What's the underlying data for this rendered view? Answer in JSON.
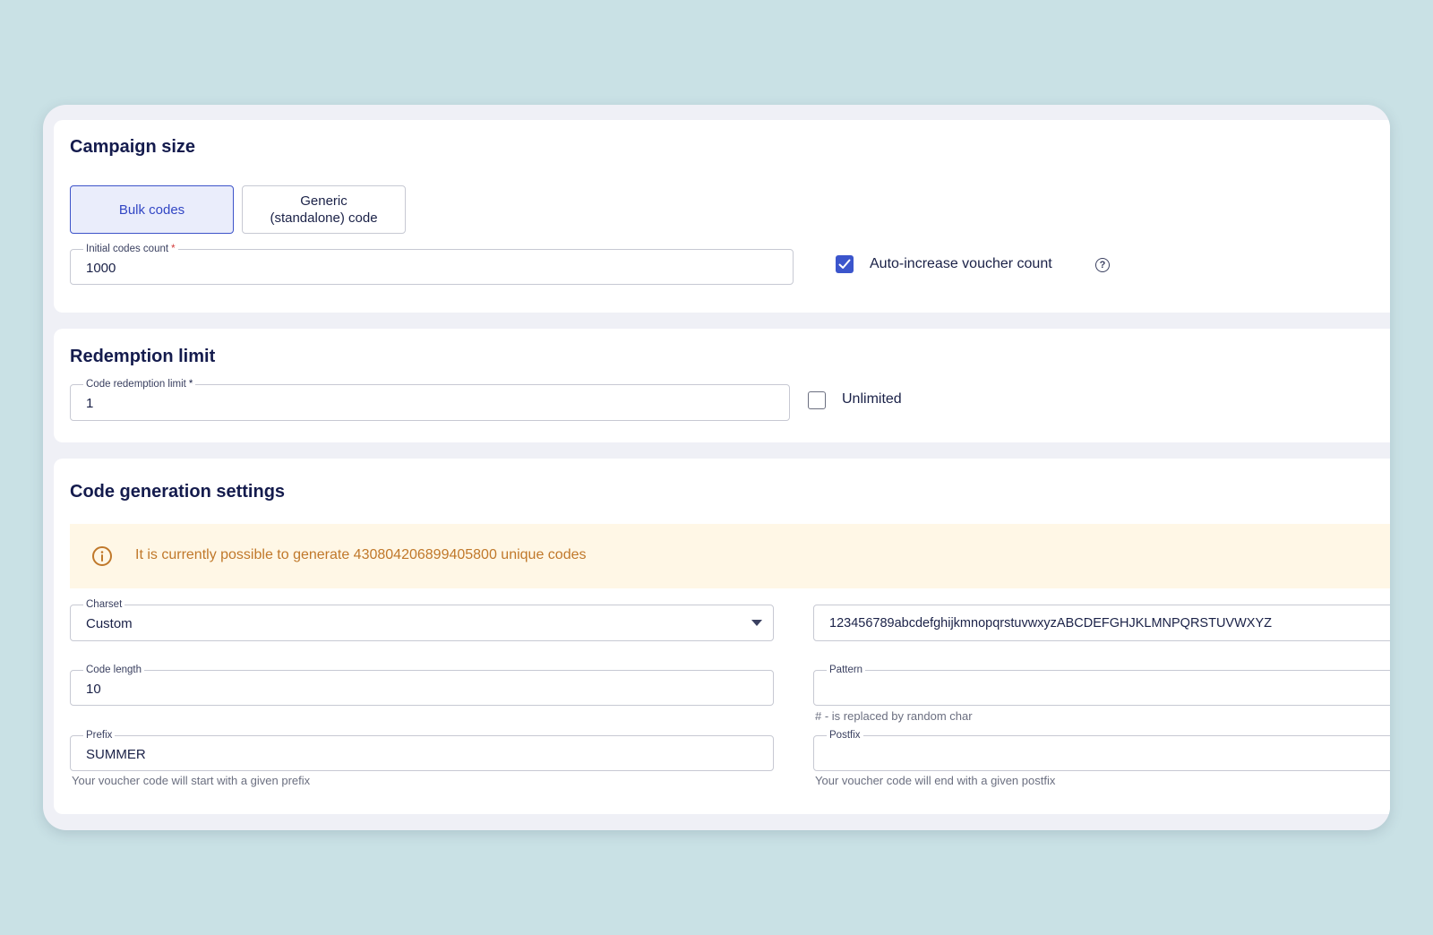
{
  "campaign_size": {
    "title": "Campaign size",
    "bulk_codes_label": "Bulk codes",
    "generic_code_label": "Generic\n(standalone) code",
    "initial_codes": {
      "label": "Initial codes count",
      "required_mark": "*",
      "value": "1000"
    },
    "auto_increase": {
      "label": "Auto-increase voucher count",
      "checked": true,
      "help_glyph": "?"
    }
  },
  "redemption_limit": {
    "title": "Redemption limit",
    "code_limit": {
      "label": "Code redemption limit",
      "required_mark": "*",
      "value": "1"
    },
    "unlimited": {
      "label": "Unlimited",
      "checked": false
    }
  },
  "code_generation": {
    "title": "Code generation settings",
    "info_text": "It is currently possible to generate 430804206899405800 unique codes",
    "charset": {
      "label": "Charset",
      "value": "Custom",
      "custom_chars": "123456789abcdefghijkmnopqrstuvwxyzABCDEFGHJKLMNPQRSTUVWXYZ"
    },
    "code_length": {
      "label": "Code length",
      "value": "10"
    },
    "pattern": {
      "label": "Pattern",
      "value": "",
      "helper": "# - is replaced by random char"
    },
    "prefix": {
      "label": "Prefix",
      "value": "SUMMER",
      "helper": "Your voucher code will start with a given prefix"
    },
    "postfix": {
      "label": "Postfix",
      "value": "",
      "helper": "Your voucher code will end with a given postfix"
    }
  },
  "colors": {
    "background": "#c9e1e5",
    "accent": "#3b55cc",
    "info_bg": "#fff7e6",
    "info_text": "#c0782a"
  },
  "icons": [
    "check-icon",
    "help-circle-icon",
    "info-circle-icon",
    "chevron-down-icon"
  ]
}
